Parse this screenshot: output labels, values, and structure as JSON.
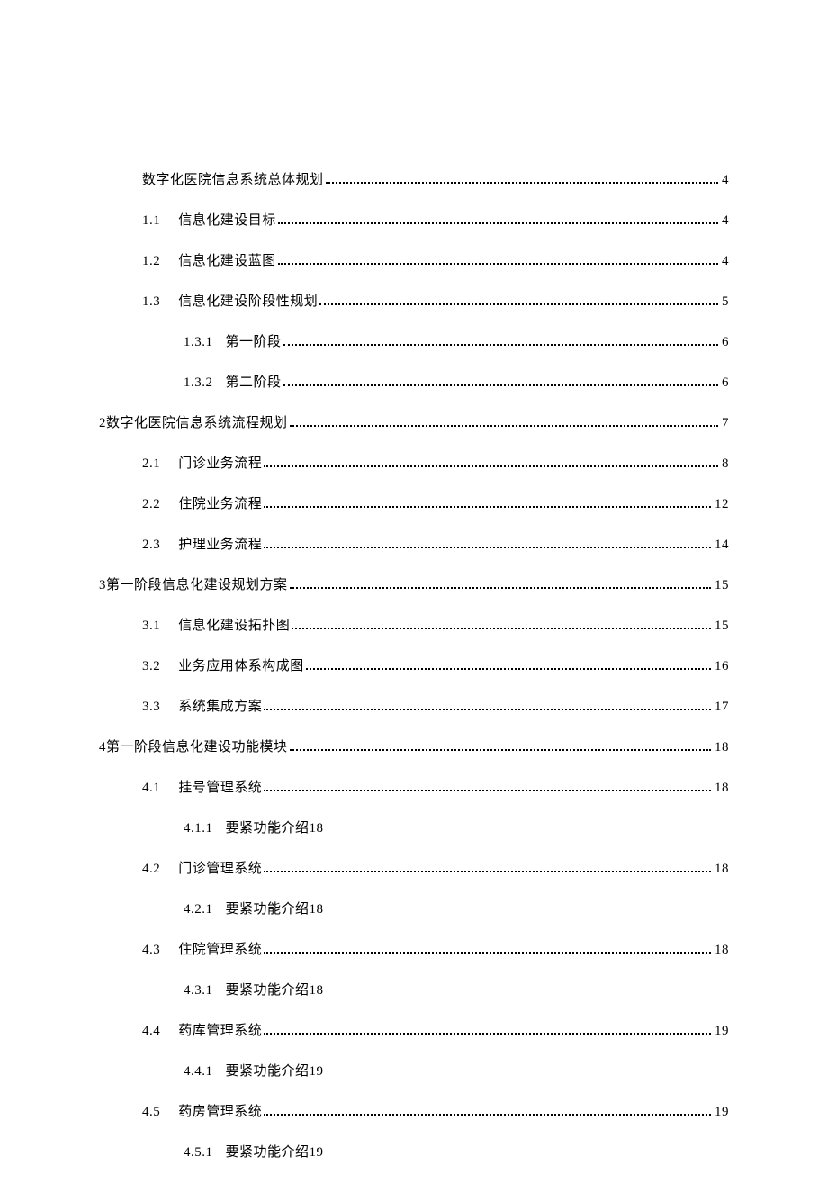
{
  "toc": [
    {
      "indent": "indent1",
      "num": "",
      "title": "数字化医院信息系统总体规划",
      "page": "4",
      "dots": true,
      "gap": ""
    },
    {
      "indent": "indent1",
      "num": "1.1",
      "title": "信息化建设目标",
      "page": "4",
      "dots": true,
      "gap": "gap-after-num"
    },
    {
      "indent": "indent1",
      "num": "1.2",
      "title": "信息化建设蓝图",
      "page": "4",
      "dots": true,
      "gap": "gap-after-num"
    },
    {
      "indent": "indent1",
      "num": "1.3",
      "title": "信息化建设阶段性规划",
      "page": "5",
      "dots": true,
      "gap": "gap-after-num"
    },
    {
      "indent": "indent2",
      "num": "1.3.1",
      "title": "第一阶段",
      "page": "6",
      "dots": true,
      "gap": "gap-after-num-sm"
    },
    {
      "indent": "indent2",
      "num": "1.3.2",
      "title": "第二阶段",
      "page": "6",
      "dots": true,
      "gap": "gap-after-num-sm"
    },
    {
      "indent": "indent0",
      "num": "2",
      "title": "数字化医院信息系统流程规划",
      "page": "7",
      "dots": true,
      "gap": ""
    },
    {
      "indent": "indent1",
      "num": "2.1",
      "title": "门诊业务流程",
      "page": "8",
      "dots": true,
      "gap": "gap-after-num"
    },
    {
      "indent": "indent1",
      "num": "2.2",
      "title": "住院业务流程",
      "page": "12",
      "dots": true,
      "gap": "gap-after-num"
    },
    {
      "indent": "indent1",
      "num": "2.3",
      "title": "护理业务流程",
      "page": "14",
      "dots": true,
      "gap": "gap-after-num"
    },
    {
      "indent": "indent0",
      "num": "3",
      "title": "第一阶段信息化建设规划方案",
      "page": "15",
      "dots": true,
      "gap": ""
    },
    {
      "indent": "indent1",
      "num": "3.1",
      "title": "信息化建设拓扑图",
      "page": "15",
      "dots": true,
      "gap": "gap-after-num"
    },
    {
      "indent": "indent1",
      "num": "3.2",
      "title": "业务应用体系构成图",
      "page": "16",
      "dots": true,
      "gap": "gap-after-num"
    },
    {
      "indent": "indent1",
      "num": "3.3",
      "title": "系统集成方案",
      "page": "17",
      "dots": true,
      "gap": "gap-after-num"
    },
    {
      "indent": "indent0",
      "num": "4",
      "title": "第一阶段信息化建设功能模块",
      "page": "18",
      "dots": true,
      "gap": ""
    },
    {
      "indent": "indent1",
      "num": "4.1",
      "title": "挂号管理系统",
      "page": "18",
      "dots": true,
      "gap": "gap-after-num"
    },
    {
      "indent": "indent2",
      "num": "4.1.1",
      "title": "要紧功能介绍18",
      "page": "",
      "dots": false,
      "gap": "gap-after-num-sm"
    },
    {
      "indent": "indent1",
      "num": "4.2",
      "title": "门诊管理系统",
      "page": "18",
      "dots": true,
      "gap": "gap-after-num"
    },
    {
      "indent": "indent2",
      "num": "4.2.1",
      "title": "要紧功能介绍18",
      "page": "",
      "dots": false,
      "gap": "gap-after-num-sm"
    },
    {
      "indent": "indent1",
      "num": "4.3",
      "title": "住院管理系统",
      "page": "18",
      "dots": true,
      "gap": "gap-after-num"
    },
    {
      "indent": "indent2",
      "num": "4.3.1",
      "title": "要紧功能介绍18",
      "page": "",
      "dots": false,
      "gap": "gap-after-num-sm"
    },
    {
      "indent": "indent1",
      "num": "4.4",
      "title": "药库管理系统",
      "page": "19",
      "dots": true,
      "gap": "gap-after-num"
    },
    {
      "indent": "indent2",
      "num": "4.4.1",
      "title": "要紧功能介绍19",
      "page": "",
      "dots": false,
      "gap": "gap-after-num-sm"
    },
    {
      "indent": "indent1",
      "num": "4.5",
      "title": "药房管理系统",
      "page": "19",
      "dots": true,
      "gap": "gap-after-num"
    },
    {
      "indent": "indent2",
      "num": "4.5.1",
      "title": "要紧功能介绍19",
      "page": "",
      "dots": false,
      "gap": "gap-after-num-sm"
    }
  ]
}
